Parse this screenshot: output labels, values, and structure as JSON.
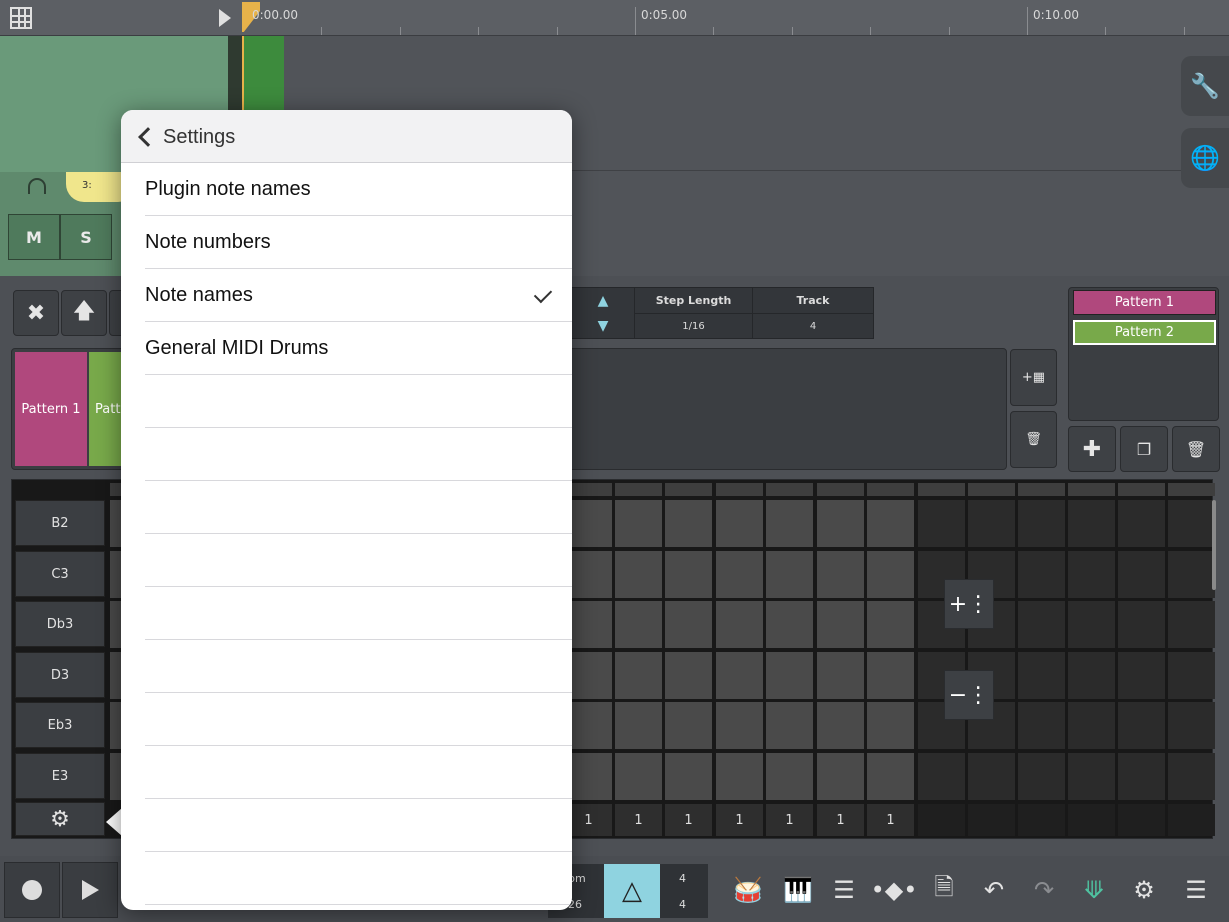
{
  "ruler": {
    "labels": [
      "0:00.00",
      "0:05.00",
      "0:10.00"
    ]
  },
  "track": {
    "mute_label": "M",
    "solo_label": "S",
    "tag_label": "3:"
  },
  "params": {
    "step_length_label": "Step Length",
    "step_length_value": "1/16",
    "track_label": "Track",
    "track_value": "4"
  },
  "patterns": {
    "list": [
      "Pattern 1",
      "Pattern 2"
    ],
    "blocks": [
      "Pattern 1",
      "Patt"
    ],
    "colors": {
      "pattern1": "#b0487d",
      "pattern2": "#78a94a"
    }
  },
  "grid": {
    "notes": [
      "B2",
      "C3",
      "Db3",
      "D3",
      "Eb3",
      "E3"
    ],
    "velocities": [
      "1",
      "1",
      "1",
      "1",
      "1",
      "1",
      "1"
    ]
  },
  "bottom": {
    "tempo_label": "pm",
    "tempo_value": "26",
    "timesig_top": "4",
    "timesig_bottom": "4"
  },
  "popover": {
    "back_label": "Settings",
    "items": [
      "Plugin note names",
      "Note numbers",
      "Note names",
      "General MIDI Drums"
    ],
    "selected_index": 2
  },
  "icons": {
    "grid": "grid-icon",
    "play": "play-icon",
    "wrench": "wrench-icon",
    "globe": "globe-music-icon",
    "close": "close-circle-icon",
    "up": "arrow-up-icon",
    "gear": "gear-icon",
    "record": "record-icon",
    "metronome": "metronome-icon"
  }
}
